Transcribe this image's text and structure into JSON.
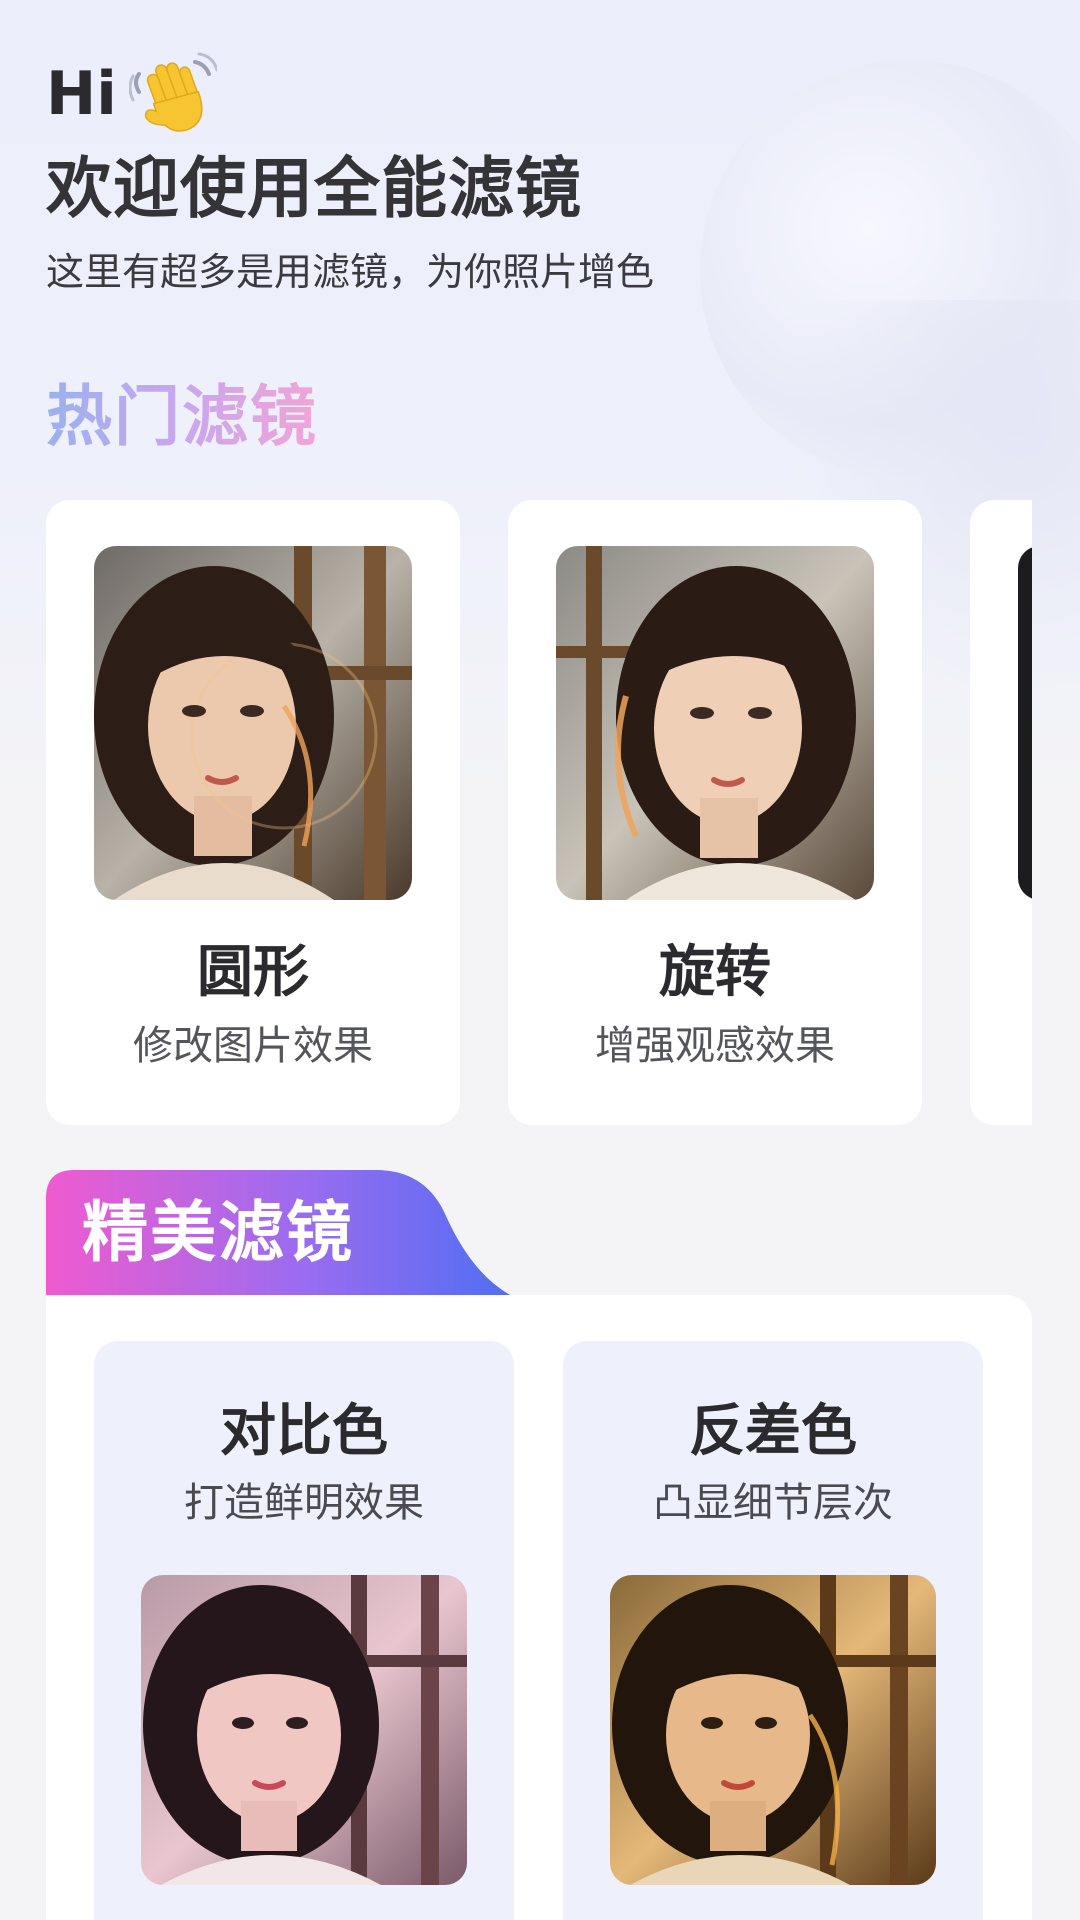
{
  "header": {
    "greeting": "Hi",
    "wave_icon": "waving-hand-icon",
    "title": "欢迎使用全能滤镜",
    "subtitle": "这里有超多是用滤镜，为你照片增色"
  },
  "hot_section": {
    "title": "热门滤镜",
    "cards": [
      {
        "name": "圆形",
        "desc": "修改图片效果"
      },
      {
        "name": "旋转",
        "desc": "增强观感效果"
      }
    ]
  },
  "featured_section": {
    "title": "精美滤镜",
    "cards": [
      {
        "name": "对比色",
        "desc": "打造鲜明效果"
      },
      {
        "name": "反差色",
        "desc": "凸显细节层次"
      }
    ]
  },
  "colors": {
    "hot_title_gradient": [
      "#9bb1ee",
      "#c9a7ee",
      "#f2a4d6"
    ],
    "featured_tab_gradient": [
      "#ef5bcf",
      "#9a6cf0",
      "#4f6ef2"
    ],
    "card_bg": "#ffffff",
    "featured_card_bg": "#eef0fc"
  }
}
